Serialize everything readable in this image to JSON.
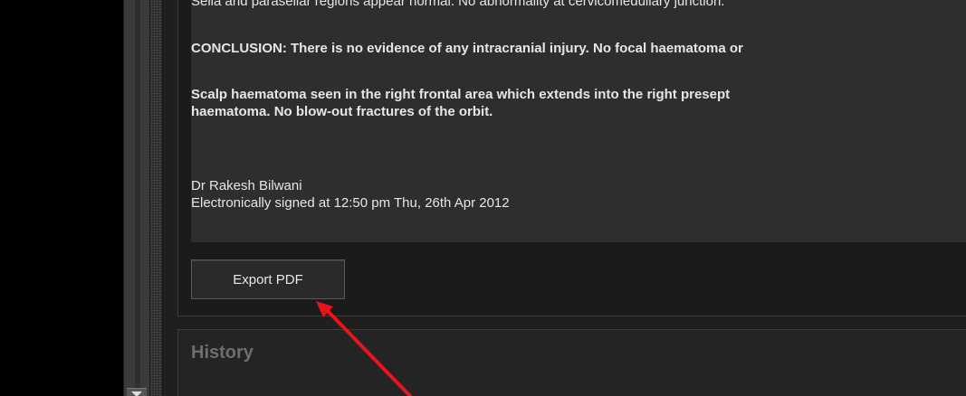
{
  "report": {
    "cutoff_line": "Sella and parasellar regions appear normal. No abnormality at cervicomedullary junction.",
    "conclusion": "CONCLUSION: There is no evidence of any intracranial injury. No focal haematoma or",
    "finding_line1": "Scalp haematoma seen in the right frontal area which extends into the right presept",
    "finding_line2": "haematoma. No blow-out fractures of the orbit.",
    "doctor_name": "Dr Rakesh Bilwani",
    "signature": "Electronically signed at 12:50 pm Thu, 26th Apr 2012"
  },
  "export_button": {
    "label": "Export PDF"
  },
  "history": {
    "title": "History"
  },
  "annotation": {
    "arrow_color": "#e8141a"
  }
}
